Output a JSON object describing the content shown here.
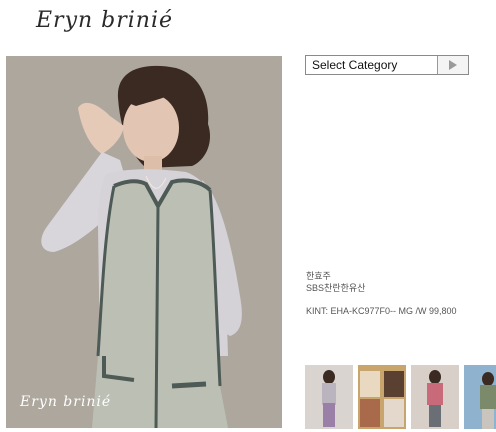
{
  "brand": {
    "logo_text": "Eryn brinié",
    "watermark_text": "Eryn brinié"
  },
  "category_select": {
    "selected": "Select Category",
    "go_icon": "play-triangle-icon"
  },
  "product": {
    "name": "한효주",
    "show": "SBS찬란한유산",
    "code_price": "KINT: EHA-KC977F0-- MG /W 99,800"
  },
  "thumbnails": [
    {
      "alt": "thumbnail-1"
    },
    {
      "alt": "thumbnail-2"
    },
    {
      "alt": "thumbnail-3"
    },
    {
      "alt": "thumbnail-4"
    }
  ],
  "colors": {
    "text": "#555555",
    "border": "#8a8a8a",
    "vest": "#b9bdb2",
    "trim": "#4d5a55"
  }
}
